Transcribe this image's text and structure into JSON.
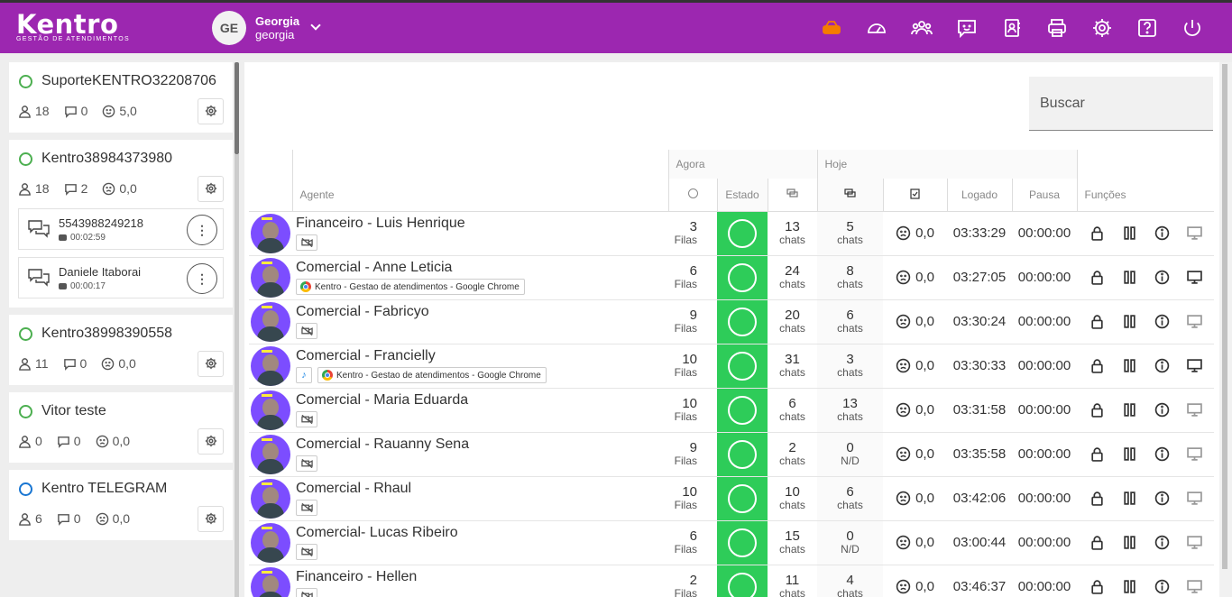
{
  "header": {
    "logo": "Kentro",
    "logo_sub": "Gestão de atendimentos",
    "user_initials": "GE",
    "user_name": "Georgia",
    "user_login": "georgia",
    "icons": [
      "router-icon",
      "dashboard-gauge-icon",
      "users-group-icon",
      "chat-message-icon",
      "contacts-book-icon",
      "printer-icon",
      "settings-gear-icon",
      "help-icon",
      "power-icon"
    ]
  },
  "sidebar": {
    "cards": [
      {
        "name": "SuporteKENTRO32208706",
        "status": "green",
        "users": "18",
        "chats": "0",
        "rating": "5,0",
        "mood": "smile",
        "chatitems": []
      },
      {
        "name": "Kentro38984373980",
        "status": "green",
        "users": "18",
        "chats": "2",
        "rating": "0,0",
        "mood": "sad",
        "chatitems": [
          {
            "number": "5543988249218",
            "time": "00:02:59"
          },
          {
            "number": "Daniele Itaborai",
            "time": "00:00:17"
          }
        ]
      },
      {
        "name": "Kentro38998390558",
        "status": "green",
        "users": "11",
        "chats": "0",
        "rating": "0,0",
        "mood": "sad",
        "chatitems": []
      },
      {
        "name": "Vitor teste",
        "status": "green",
        "users": "0",
        "chats": "0",
        "rating": "0,0",
        "mood": "sad",
        "chatitems": []
      },
      {
        "name": "Kentro TELEGRAM",
        "status": "blue",
        "users": "6",
        "chats": "0",
        "rating": "0,0",
        "mood": "sad",
        "chatitems": []
      }
    ],
    "more_label": "⋮"
  },
  "main": {
    "search_placeholder": "Buscar",
    "groups": {
      "agora": "Agora",
      "hoje": "Hoje"
    },
    "columns": {
      "agente": "Agente",
      "estado": "Estado",
      "logado": "Logado",
      "pausa": "Pausa",
      "funcoes": "Funções"
    },
    "rows": [
      {
        "name": "Financeiro - Luis Henrique",
        "filas": "3",
        "filas_label": "Filas",
        "chats_now": "13",
        "chats_now_label": "chats",
        "chats_today": "5",
        "chats_today_label": "chats",
        "rating": "0,0",
        "logado": "03:33:29",
        "pausa": "00:00:00",
        "chrome": "",
        "music": false,
        "monitor_on": false
      },
      {
        "name": "Comercial - Anne Leticia",
        "filas": "6",
        "filas_label": "Filas",
        "chats_now": "24",
        "chats_now_label": "chats",
        "chats_today": "8",
        "chats_today_label": "chats",
        "rating": "0,0",
        "logado": "03:27:05",
        "pausa": "00:00:00",
        "chrome": "Kentro - Gestao de atendimentos - Google Chrome",
        "music": false,
        "monitor_on": true
      },
      {
        "name": "Comercial - Fabricyo",
        "filas": "9",
        "filas_label": "Filas",
        "chats_now": "20",
        "chats_now_label": "chats",
        "chats_today": "6",
        "chats_today_label": "chats",
        "rating": "0,0",
        "logado": "03:30:24",
        "pausa": "00:00:00",
        "chrome": "",
        "music": false,
        "monitor_on": false
      },
      {
        "name": "Comercial - Francielly",
        "filas": "10",
        "filas_label": "Filas",
        "chats_now": "31",
        "chats_now_label": "chats",
        "chats_today": "3",
        "chats_today_label": "chats",
        "rating": "0,0",
        "logado": "03:30:33",
        "pausa": "00:00:00",
        "chrome": "Kentro - Gestao de atendimentos - Google Chrome",
        "music": true,
        "monitor_on": true
      },
      {
        "name": "Comercial - Maria Eduarda",
        "filas": "10",
        "filas_label": "Filas",
        "chats_now": "6",
        "chats_now_label": "chats",
        "chats_today": "13",
        "chats_today_label": "chats",
        "rating": "0,0",
        "logado": "03:31:58",
        "pausa": "00:00:00",
        "chrome": "",
        "music": false,
        "monitor_on": false
      },
      {
        "name": "Comercial - Rauanny Sena",
        "filas": "9",
        "filas_label": "Filas",
        "chats_now": "2",
        "chats_now_label": "chats",
        "chats_today": "0",
        "chats_today_label": "N/D",
        "rating": "0,0",
        "logado": "03:35:58",
        "pausa": "00:00:00",
        "chrome": "",
        "music": false,
        "monitor_on": false
      },
      {
        "name": "Comercial - Rhaul",
        "filas": "10",
        "filas_label": "Filas",
        "chats_now": "10",
        "chats_now_label": "chats",
        "chats_today": "6",
        "chats_today_label": "chats",
        "rating": "0,0",
        "logado": "03:42:06",
        "pausa": "00:00:00",
        "chrome": "",
        "music": false,
        "monitor_on": false
      },
      {
        "name": "Comercial- Lucas Ribeiro",
        "filas": "6",
        "filas_label": "Filas",
        "chats_now": "15",
        "chats_now_label": "chats",
        "chats_today": "0",
        "chats_today_label": "N/D",
        "rating": "0,0",
        "logado": "03:00:44",
        "pausa": "00:00:00",
        "chrome": "",
        "music": false,
        "monitor_on": false
      },
      {
        "name": "Financeiro - Hellen",
        "filas": "2",
        "filas_label": "Filas",
        "chats_now": "11",
        "chats_now_label": "chats",
        "chats_today": "4",
        "chats_today_label": "chats",
        "rating": "0,0",
        "logado": "03:46:37",
        "pausa": "00:00:00",
        "chrome": "",
        "music": false,
        "monitor_on": false
      }
    ]
  },
  "colors": {
    "header": "#9c27b0",
    "online": "#2ecc59",
    "status_green": "#4caf50",
    "status_blue": "#1976d2"
  }
}
